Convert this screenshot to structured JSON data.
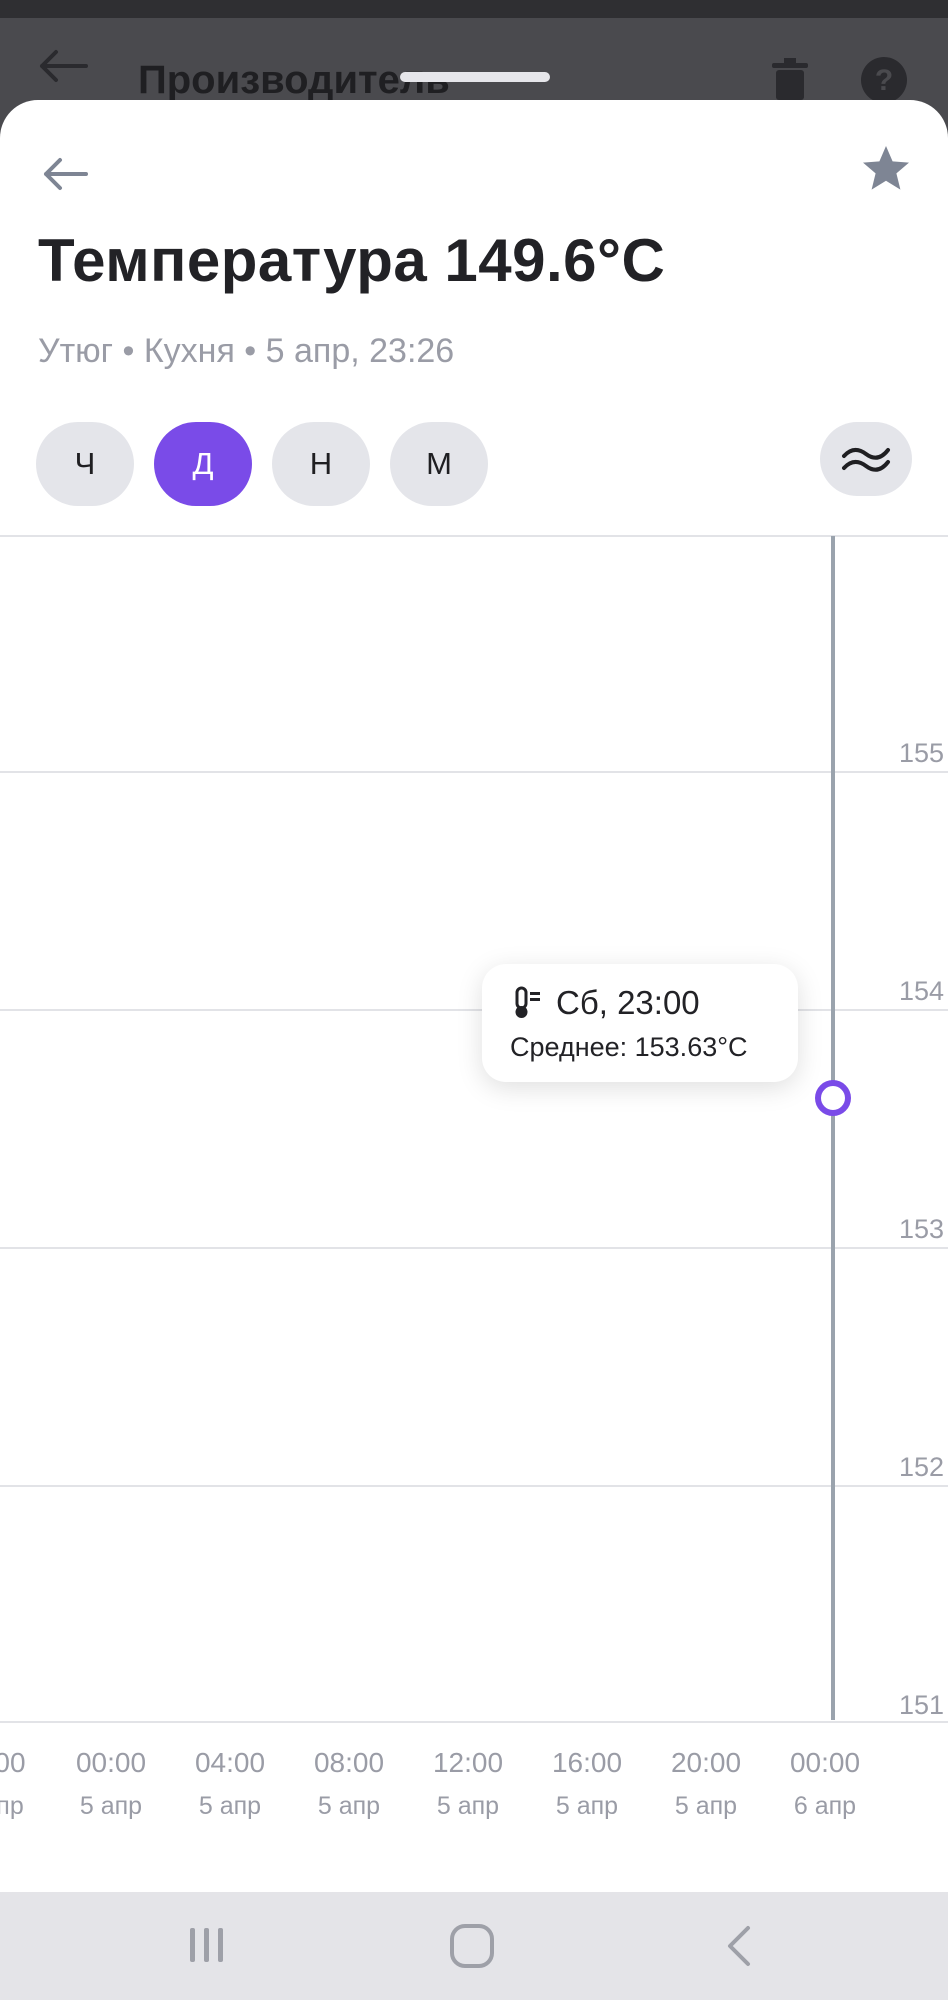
{
  "background": {
    "title": "Производитель"
  },
  "header": {
    "title": "Температура 149.6°C",
    "subtitle": "Утюг • Кухня • 5 апр, 23:26"
  },
  "period_tabs": [
    {
      "label": "Ч",
      "active": false
    },
    {
      "label": "Д",
      "active": true
    },
    {
      "label": "Н",
      "active": false
    },
    {
      "label": "М",
      "active": false
    }
  ],
  "colors": {
    "accent": "#7a4be8",
    "cursor_line": "#9aa3ad",
    "grid": "#e2e3e7"
  },
  "tooltip": {
    "time": "Сб, 23:00",
    "average": "Среднее: 153.63°C"
  },
  "chart_data": {
    "type": "line",
    "y_ticks": [
      "155",
      "154",
      "153",
      "152",
      "151"
    ],
    "ylim": [
      150.7,
      155.9
    ],
    "x_ticks": [
      {
        "time": "00",
        "date": "пр"
      },
      {
        "time": "00:00",
        "date": "5 апр"
      },
      {
        "time": "04:00",
        "date": "5 апр"
      },
      {
        "time": "08:00",
        "date": "5 апр"
      },
      {
        "time": "12:00",
        "date": "5 апр"
      },
      {
        "time": "16:00",
        "date": "5 апр"
      },
      {
        "time": "20:00",
        "date": "5 апр"
      },
      {
        "time": "00:00",
        "date": "6 апр"
      }
    ],
    "series": [
      {
        "points": [
          {
            "x": "Сб, 23:00",
            "y": 153.63
          }
        ]
      }
    ],
    "grid": true
  }
}
